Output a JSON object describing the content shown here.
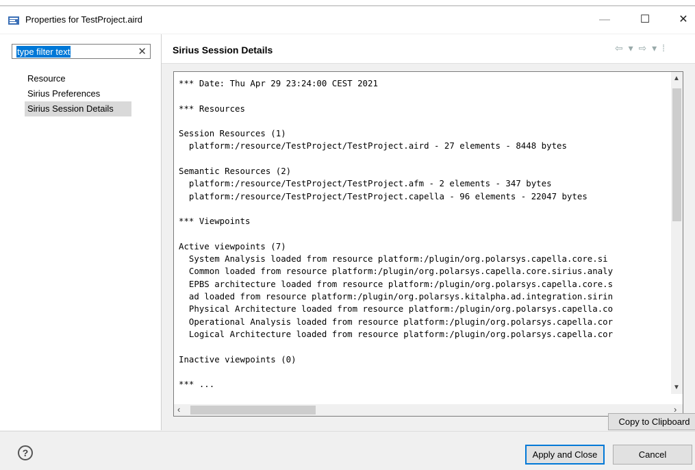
{
  "window": {
    "title": "Properties for TestProject.aird",
    "minimize_glyph": "—",
    "maximize_glyph": "☐",
    "close_glyph": "✕"
  },
  "filter": {
    "value": "type filter text",
    "clear_glyph": "✕"
  },
  "tree": {
    "items": [
      {
        "label": "Resource",
        "selected": false
      },
      {
        "label": "Sirius Preferences",
        "selected": false
      },
      {
        "label": "Sirius Session Details",
        "selected": true
      }
    ]
  },
  "page": {
    "title": "Sirius Session Details",
    "nav": "⇦ ▾ ⇨ ▾ ⁞"
  },
  "details_text": [
    "*** Date: Thu Apr 29 23:24:00 CEST 2021",
    "",
    "*** Resources",
    "",
    "Session Resources (1)",
    "  platform:/resource/TestProject/TestProject.aird - 27 elements - 8448 bytes",
    "",
    "Semantic Resources (2)",
    "  platform:/resource/TestProject/TestProject.afm - 2 elements - 347 bytes",
    "  platform:/resource/TestProject/TestProject.capella - 96 elements - 22047 bytes",
    "",
    "*** Viewpoints",
    "",
    "Active viewpoints (7)",
    "  System Analysis loaded from resource platform:/plugin/org.polarsys.capella.core.si",
    "  Common loaded from resource platform:/plugin/org.polarsys.capella.core.sirius.analy",
    "  EPBS architecture loaded from resource platform:/plugin/org.polarsys.capella.core.s",
    "  ad loaded from resource platform:/plugin/org.polarsys.kitalpha.ad.integration.sirin",
    "  Physical Architecture loaded from resource platform:/plugin/org.polarsys.capella.co",
    "  Operational Analysis loaded from resource platform:/plugin/org.polarsys.capella.cor",
    "  Logical Architecture loaded from resource platform:/plugin/org.polarsys.capella.cor",
    "",
    "Inactive viewpoints (0)",
    "",
    "*** ..."
  ],
  "buttons": {
    "copy": "Copy to Clipboard",
    "apply": "Apply and Close",
    "cancel": "Cancel",
    "help": "?"
  },
  "scroll": {
    "up": "▲",
    "down": "▼",
    "left": "‹",
    "right": "›"
  }
}
